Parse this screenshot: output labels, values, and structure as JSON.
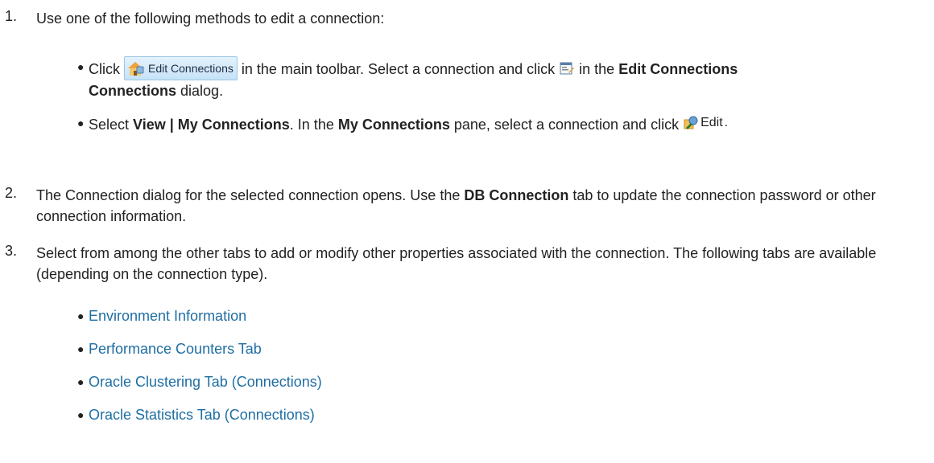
{
  "steps": [
    {
      "number": "1.",
      "text": "Use one of the following methods to edit a connection:",
      "bullets": [
        {
          "click": "Click",
          "toolbar_button_label": "Edit Connections",
          "after_button": "in the main toolbar. Select a connection and click",
          "in_the": "in the",
          "bold_dialog": "Edit Connections",
          "dialog": "dialog."
        },
        {
          "select": "Select",
          "bold_menu": "View | My Connections",
          "in_the": ". In the",
          "bold_pane": "My Connections",
          "rest": "pane, select a connection and click",
          "edit_label": "Edit",
          "end": "."
        }
      ]
    },
    {
      "number": "2.",
      "pre": "The Connection dialog for the selected connection opens. Use the",
      "bold_tab": "DB Connection",
      "post": "tab to update the connection password or other connection information."
    },
    {
      "number": "3.",
      "text": "Select from among the other tabs to add or modify other properties associated with the connection. The following tabs are available (depending on the connection type).",
      "links": [
        "Environment Information",
        "Performance Counters Tab",
        "Oracle Clustering Tab (Connections)",
        "Oracle Statistics Tab (Connections)"
      ]
    }
  ],
  "colors": {
    "link": "#1f6ea3",
    "text": "#222222"
  },
  "icons": [
    "bullet-dot",
    "edit-connections-icon",
    "edit-properties-icon",
    "edit-icon"
  ]
}
